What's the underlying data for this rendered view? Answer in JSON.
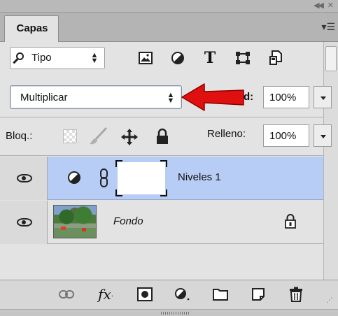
{
  "panel": {
    "tab_label": "Capas",
    "filter": {
      "selected": "Tipo"
    },
    "blend_mode": {
      "selected": "Multiplicar"
    },
    "opacity": {
      "label_visible": "d:",
      "value": "100%"
    },
    "lock": {
      "label": "Bloq.:"
    },
    "fill": {
      "label": "Relleno:",
      "value": "100%"
    },
    "filter_icons": [
      "pixel-layer-filter-icon",
      "adjustment-layer-filter-icon",
      "type-layer-filter-icon",
      "shape-layer-filter-icon",
      "smart-object-filter-icon"
    ],
    "lock_icons": [
      "lock-transparent-icon",
      "lock-image-icon",
      "lock-position-icon",
      "lock-all-icon"
    ],
    "bottom_icons": [
      "link-layers-icon",
      "layer-style-icon",
      "add-mask-icon",
      "new-adjustment-icon",
      "new-group-icon",
      "new-layer-icon",
      "delete-layer-icon"
    ]
  },
  "layers": [
    {
      "name": "Niveles 1",
      "kind": "adjustment",
      "selected": true,
      "visible": true
    },
    {
      "name": "Fondo",
      "kind": "background",
      "selected": false,
      "visible": true,
      "locked": true
    }
  ],
  "annotation": {
    "arrow_color": "#e01010"
  },
  "colors": {
    "selected_layer": "#b8cdf5",
    "panel_bg": "#e3e3e3"
  }
}
